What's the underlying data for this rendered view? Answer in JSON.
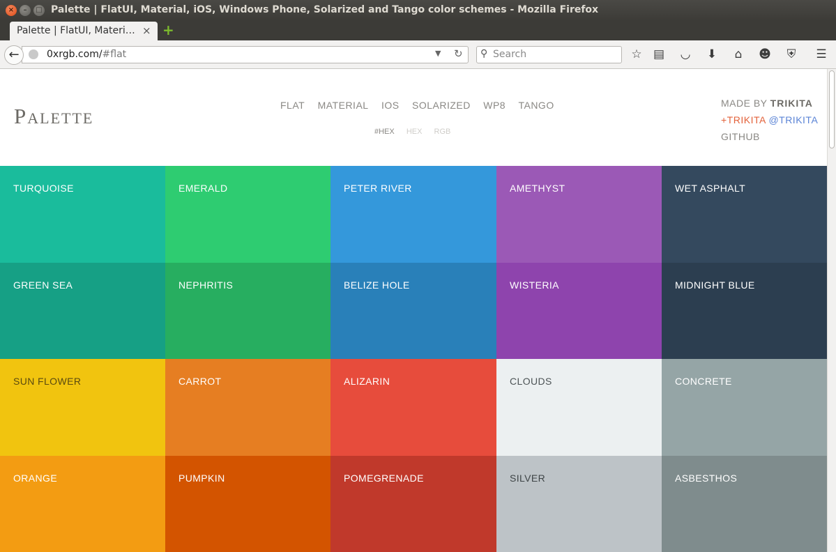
{
  "window": {
    "title": "Palette | FlatUI, Material, iOS, Windows Phone, Solarized and Tango color schemes - Mozilla Firefox"
  },
  "tab": {
    "label": "Palette | FlatUI, Materi…",
    "close": "×",
    "new_tab": "+"
  },
  "navbar": {
    "url_host": "0xrgb.com/",
    "url_rest": "#flat",
    "search_placeholder": "Search"
  },
  "header": {
    "logo": "Palette",
    "nav": [
      "FLAT",
      "MATERIAL",
      "IOS",
      "SOLARIZED",
      "WP8",
      "TANGO"
    ],
    "formats": [
      "#HEX",
      "HEX",
      "RGB"
    ],
    "credits": {
      "made_by_prefix": "MADE BY",
      "made_by_name": "TRIKITA",
      "gplus": "+TRIKITA",
      "twitter": "@TRIKITA",
      "github": "GITHUB"
    }
  },
  "colors": [
    {
      "name": "TURQUOISE",
      "hex": "#1abc9c",
      "text": "#ffffff"
    },
    {
      "name": "EMERALD",
      "hex": "#2ecc71",
      "text": "#ffffff"
    },
    {
      "name": "PETER RIVER",
      "hex": "#3498db",
      "text": "#ffffff"
    },
    {
      "name": "AMETHYST",
      "hex": "#9b59b6",
      "text": "#ffffff"
    },
    {
      "name": "WET ASPHALT",
      "hex": "#34495e",
      "text": "#ffffff"
    },
    {
      "name": "GREEN SEA",
      "hex": "#16a085",
      "text": "#ffffff"
    },
    {
      "name": "NEPHRITIS",
      "hex": "#27ae60",
      "text": "#ffffff"
    },
    {
      "name": "BELIZE HOLE",
      "hex": "#2980b9",
      "text": "#ffffff"
    },
    {
      "name": "WISTERIA",
      "hex": "#8e44ad",
      "text": "#ffffff"
    },
    {
      "name": "MIDNIGHT BLUE",
      "hex": "#2c3e50",
      "text": "#ffffff"
    },
    {
      "name": "SUN FLOWER",
      "hex": "#f1c40f",
      "text": "#5a4a10"
    },
    {
      "name": "CARROT",
      "hex": "#e67e22",
      "text": "#ffffff"
    },
    {
      "name": "ALIZARIN",
      "hex": "#e74c3c",
      "text": "#ffffff"
    },
    {
      "name": "CLOUDS",
      "hex": "#ecf0f1",
      "text": "#4d5456"
    },
    {
      "name": "CONCRETE",
      "hex": "#95a5a6",
      "text": "#ffffff"
    },
    {
      "name": "ORANGE",
      "hex": "#f39c12",
      "text": "#ffffff"
    },
    {
      "name": "PUMPKIN",
      "hex": "#d35400",
      "text": "#ffffff"
    },
    {
      "name": "POMEGRENADE",
      "hex": "#c0392b",
      "text": "#ffffff"
    },
    {
      "name": "SILVER",
      "hex": "#bdc3c7",
      "text": "#3f4547"
    },
    {
      "name": "ASBESTHOS",
      "hex": "#7f8c8d",
      "text": "#ffffff"
    }
  ]
}
